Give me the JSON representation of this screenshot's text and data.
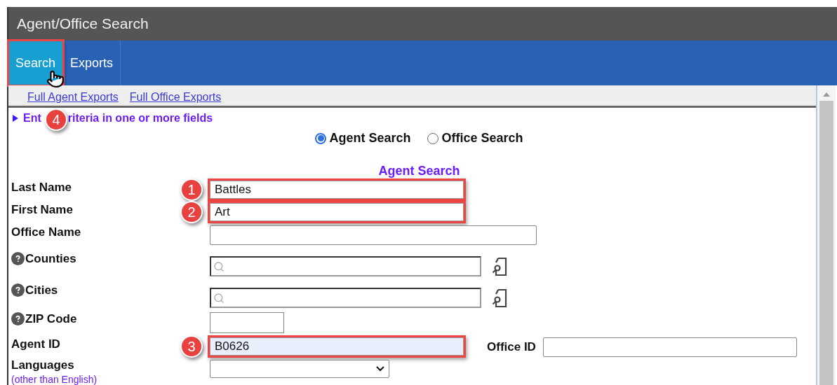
{
  "window": {
    "title": "Agent/Office Search"
  },
  "tabs": [
    {
      "label": "Search",
      "selected": true,
      "highlighted": true,
      "callout": "4"
    },
    {
      "label": "Exports",
      "selected": false,
      "highlighted": false
    }
  ],
  "sub_links": [
    "Full Agent Exports",
    "Full Office Exports"
  ],
  "instruction": {
    "parts": [
      "Ent",
      "riteria in one or more fields"
    ]
  },
  "search_type": [
    {
      "label": "Agent Search",
      "selected": true
    },
    {
      "label": "Office Search",
      "selected": false
    }
  ],
  "section_title": "Agent Search",
  "fields": [
    {
      "kind": "text",
      "label": "Last Name",
      "value": "Battles",
      "help": false,
      "highlighted": true,
      "callout": "1"
    },
    {
      "kind": "text",
      "label": "First Name",
      "value": "Art",
      "help": false,
      "highlighted": true,
      "callout": "2"
    },
    {
      "kind": "wide",
      "label": "Office Name",
      "help": false,
      "highlighted": false
    },
    {
      "kind": "lookup",
      "label": "Counties",
      "help": true,
      "highlighted": false
    },
    {
      "kind": "lookup",
      "label": "Cities",
      "help": true,
      "highlighted": false
    },
    {
      "kind": "short",
      "label": "ZIP Code",
      "help": true,
      "highlighted": false
    },
    {
      "kind": "text",
      "label": "Agent ID",
      "value": "B0626",
      "help": false,
      "highlighted": true,
      "callout": "3",
      "side_label": "Office ID"
    },
    {
      "kind": "select",
      "label": "Languages",
      "note": "(other than English)",
      "help": false,
      "highlighted": false
    }
  ]
}
